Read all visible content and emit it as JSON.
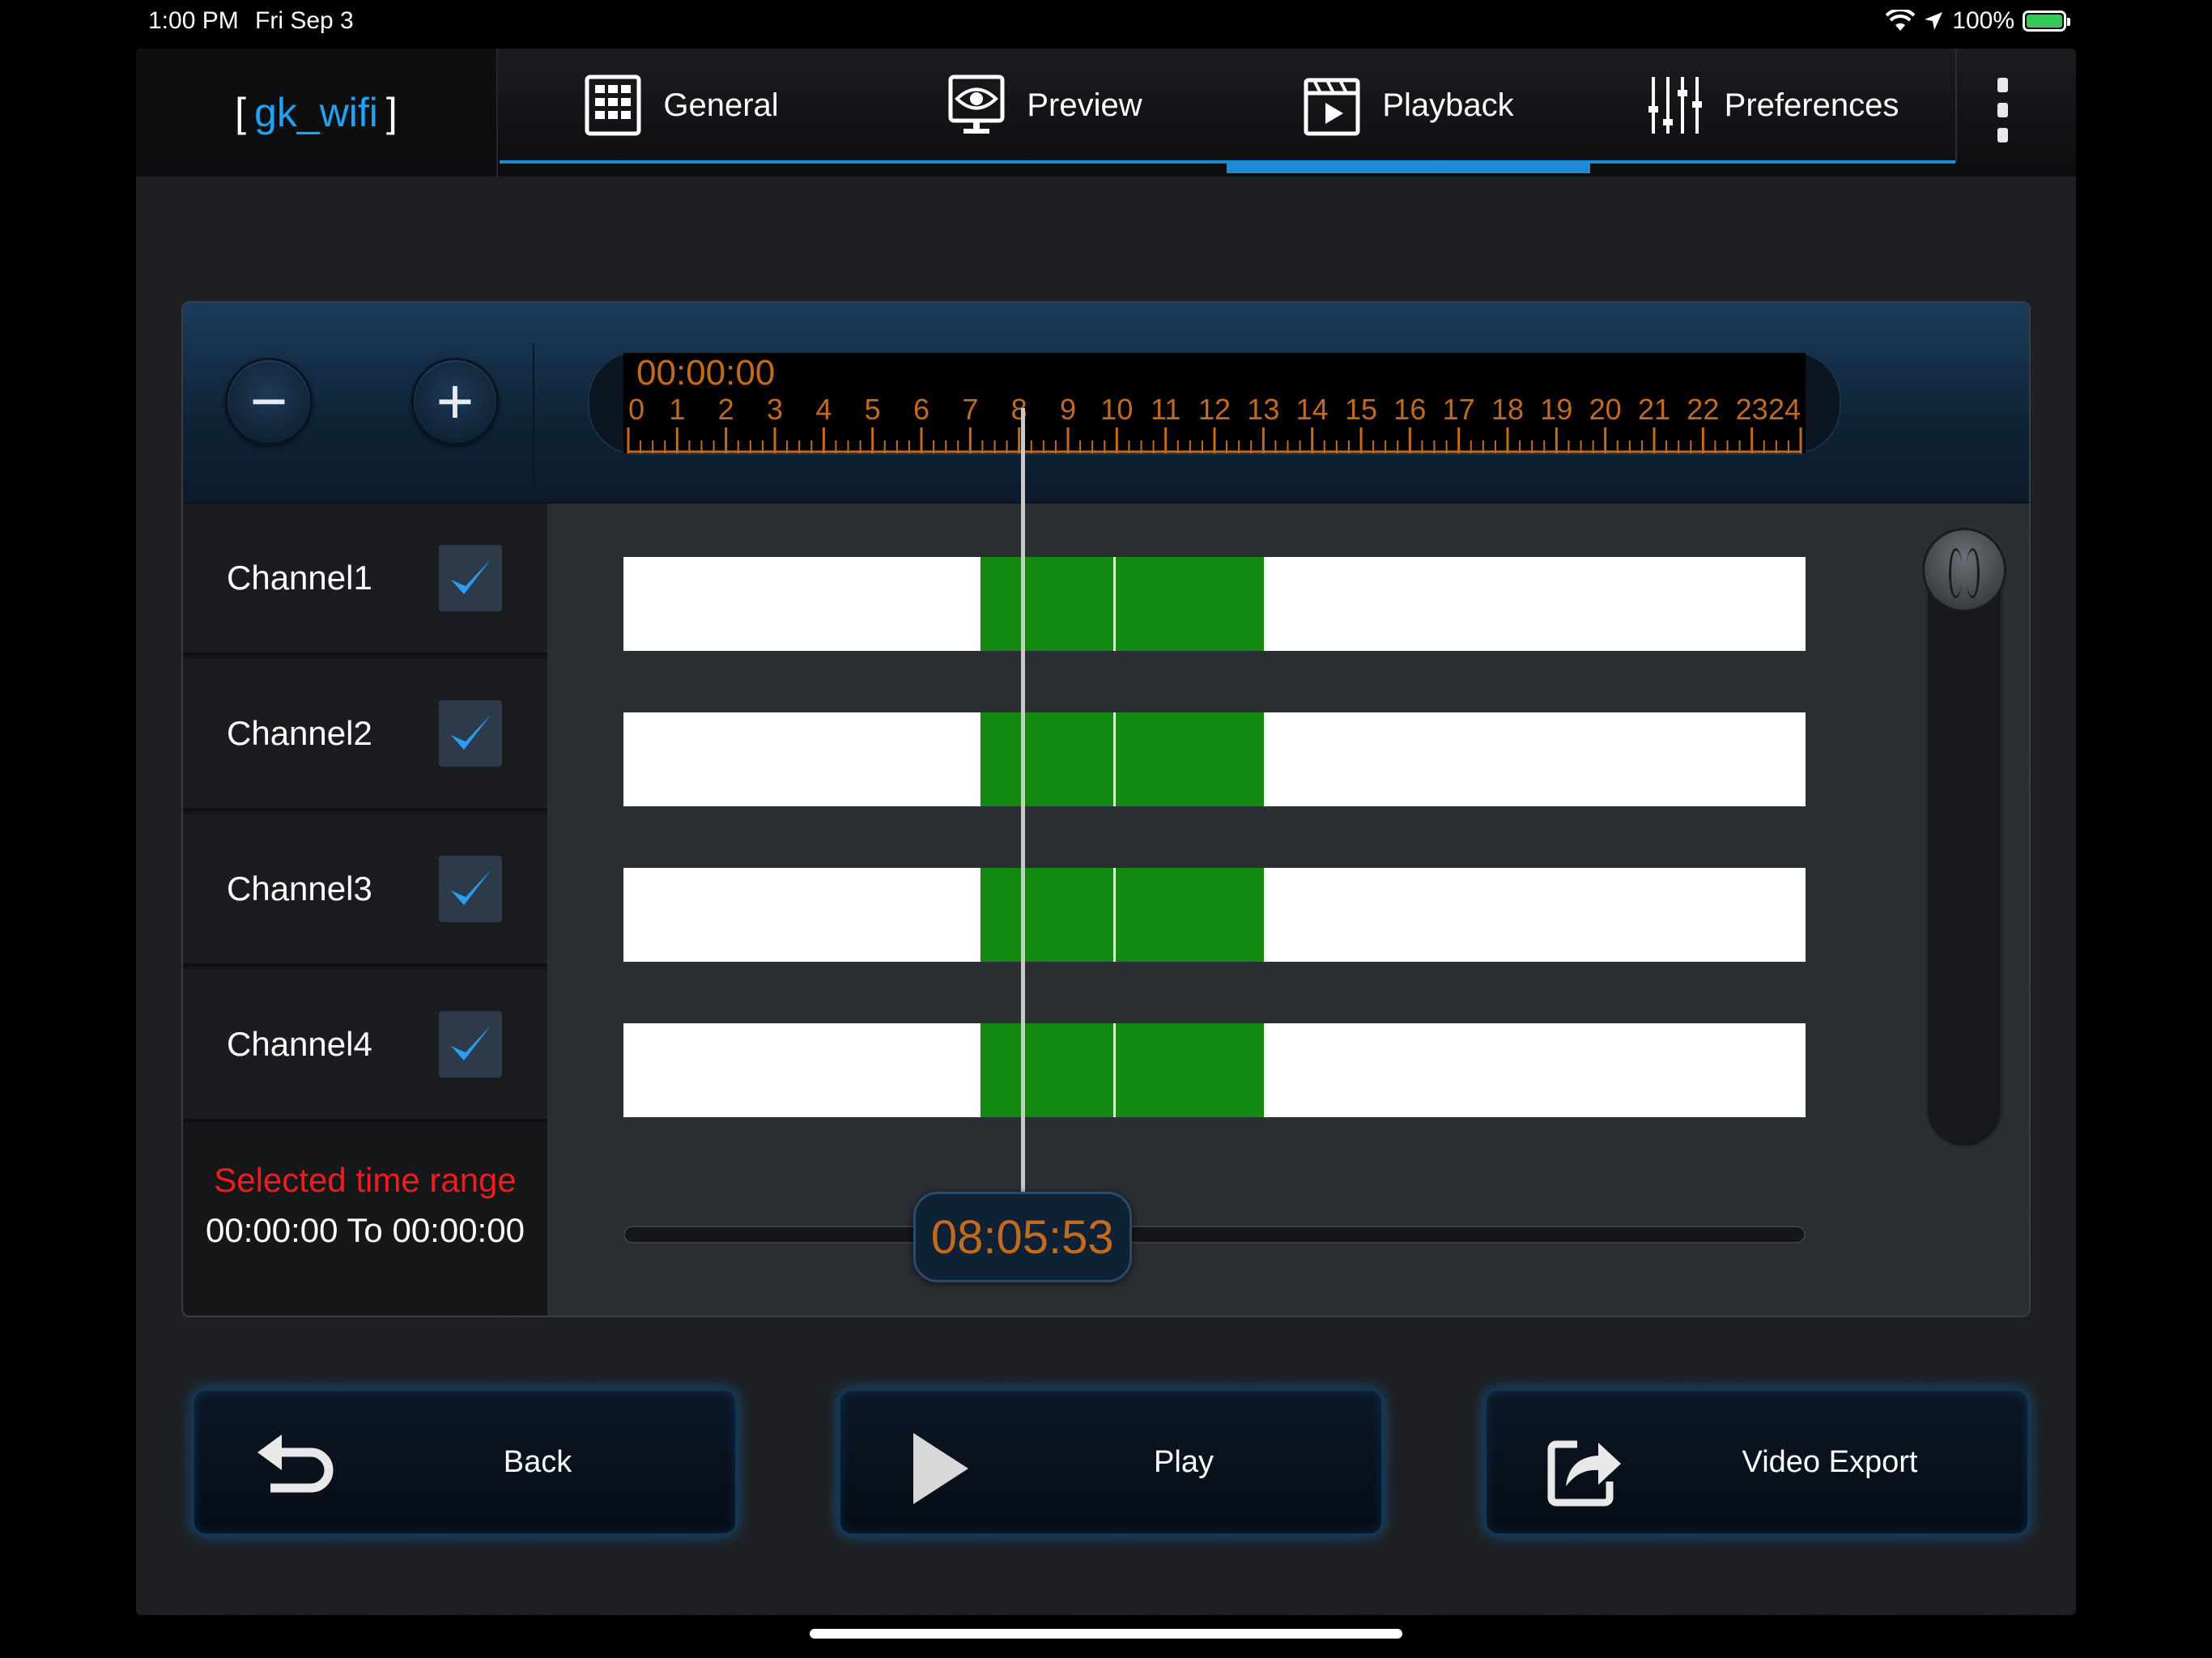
{
  "status_bar": {
    "time": "1:00 PM",
    "date": "Fri Sep 3",
    "battery": "100%"
  },
  "header": {
    "brand_open": "[",
    "brand_name": "gk_wifi",
    "brand_close": "]",
    "tabs": [
      {
        "label": "General",
        "icon": "grid-icon"
      },
      {
        "label": "Preview",
        "icon": "eye-monitor-icon"
      },
      {
        "label": "Playback",
        "icon": "clapperboard-play-icon",
        "active": true
      },
      {
        "label": "Preferences",
        "icon": "sliders-icon"
      }
    ],
    "menu_icon": "more-vertical-icon"
  },
  "timeline": {
    "zoom_out": "−",
    "zoom_in": "+",
    "ruler_time": "00:00:00",
    "hour_labels": [
      "0",
      "1",
      "2",
      "3",
      "4",
      "5",
      "6",
      "7",
      "8",
      "9",
      "10",
      "11",
      "12",
      "13",
      "14",
      "15",
      "16",
      "17",
      "18",
      "19",
      "20",
      "21",
      "22",
      "23",
      "24"
    ],
    "current_time": "08:05:53",
    "playhead_hour": 8.1,
    "recording_segment": {
      "start_hour": 7.25,
      "end_hour": 13.0,
      "divider_hour": 9.95
    },
    "channels": [
      {
        "label": "Channel1",
        "checked": true
      },
      {
        "label": "Channel2",
        "checked": true
      },
      {
        "label": "Channel3",
        "checked": true
      },
      {
        "label": "Channel4",
        "checked": true
      }
    ],
    "selected_range_title": "Selected time range",
    "selected_range_value": "00:00:00 To 00:00:00"
  },
  "actions": {
    "back": "Back",
    "play": "Play",
    "export": "Video Export"
  },
  "colors": {
    "accent": "#1e8ad6",
    "brand": "#1ea3f5",
    "ruler_text": "#c46a1c",
    "recording": "#128a12",
    "range_title": "#f01c1c"
  }
}
